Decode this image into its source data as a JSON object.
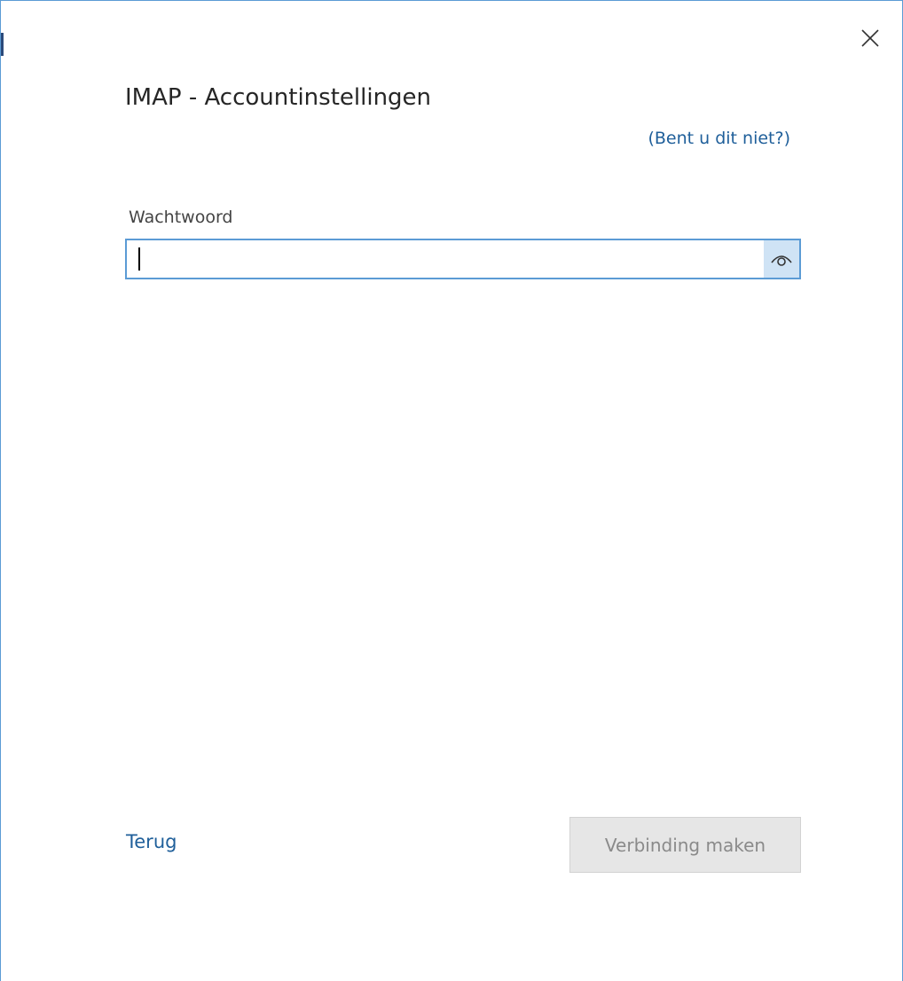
{
  "dialog": {
    "title": "IMAP - Accountinstellingen",
    "not_you_link": "(Bent u dit niet?)"
  },
  "password": {
    "label": "Wachtwoord",
    "value": "",
    "placeholder": ""
  },
  "footer": {
    "back_label": "Terug",
    "connect_label": "Verbinding maken"
  },
  "icons": {
    "close": "close-icon",
    "reveal": "eye-icon"
  },
  "colors": {
    "link": "#1f5f9a",
    "field_border": "#5b9bd5",
    "reveal_bg": "#cfe3f5",
    "disabled_button_bg": "#e6e6e6",
    "disabled_button_text": "#8a8a8a"
  }
}
